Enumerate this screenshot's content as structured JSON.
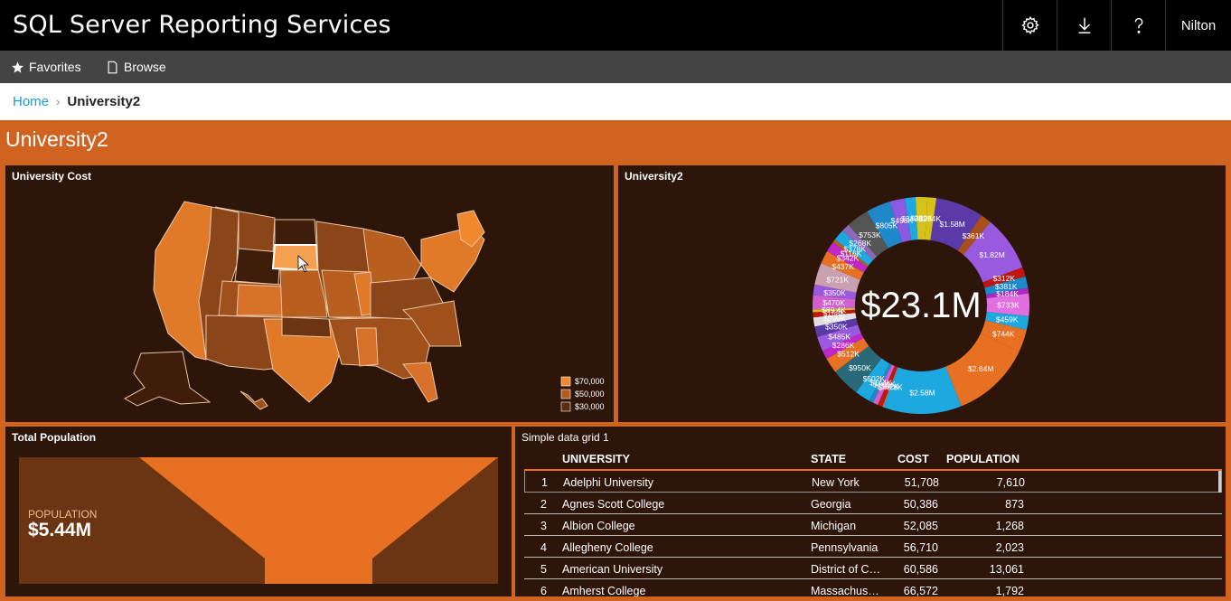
{
  "app": {
    "title": "SQL Server Reporting Services",
    "user": "Nilton"
  },
  "nav": {
    "favorites": "Favorites",
    "browse": "Browse"
  },
  "breadcrumb": {
    "home": "Home",
    "current": "University2"
  },
  "page": {
    "title": "University2"
  },
  "colors": {
    "accent": "#d0631f",
    "tile_bg": "#2e1509",
    "link": "#1c9bd7"
  },
  "tiles": {
    "map": {
      "title": "University Cost",
      "legend": [
        {
          "label": "$70,000",
          "color": "#f0882e"
        },
        {
          "label": "$50,000",
          "color": "#b05a1c"
        },
        {
          "label": "$30,000",
          "color": "#5c2e10"
        }
      ]
    },
    "donut": {
      "title": "University2",
      "center_value": "$23.1M",
      "labels": [
        "$294K",
        "$1.58M",
        "$361K",
        "$1.82M",
        "$312K",
        "$381K",
        "$184K",
        "$733K",
        "$459K",
        "$744K",
        "$2.64M",
        "$2.58M",
        "$48.8K",
        "$162K",
        "$169K",
        "$144K",
        "$502K",
        "$950K",
        "$512K",
        "$286K",
        "$485K",
        "$350K",
        "$299K",
        "$168K",
        "$89.4K",
        "$470K",
        "$350K",
        "$721K",
        "$437K",
        "$342K",
        "$116K",
        "$378K",
        "$268K",
        "$753K",
        "$805K",
        "$498K",
        "$349K",
        "$389K"
      ]
    },
    "funnel": {
      "title": "Total Population",
      "label": "POPULATION",
      "value": "$5.44M"
    },
    "grid": {
      "title": "Simple data grid 1",
      "columns": [
        "UNIVERSITY",
        "STATE",
        "COST",
        "POPULATION"
      ],
      "rows": [
        {
          "num": "1",
          "university": "Adelphi University",
          "state": "New York",
          "cost": "51,708",
          "population": "7,610"
        },
        {
          "num": "2",
          "university": "Agnes Scott College",
          "state": "Georgia",
          "cost": "50,386",
          "population": "873"
        },
        {
          "num": "3",
          "university": "Albion College",
          "state": "Michigan",
          "cost": "52,085",
          "population": "1,268"
        },
        {
          "num": "4",
          "university": "Allegheny College",
          "state": "Pennsylvania",
          "cost": "56,710",
          "population": "2,023"
        },
        {
          "num": "5",
          "university": "American University",
          "state": "District of Col...",
          "cost": "60,586",
          "population": "13,061"
        },
        {
          "num": "6",
          "university": "Amherst College",
          "state": "Massachusetts",
          "cost": "66,572",
          "population": "1,792"
        }
      ]
    }
  },
  "chart_data": {
    "type": "pie",
    "title": "University2",
    "center_label": "$23.1M",
    "values": [
      294,
      1580,
      361,
      1820,
      312,
      381,
      184,
      733,
      459,
      744,
      2640,
      2580,
      48.8,
      162,
      169,
      144,
      502,
      950,
      512,
      286,
      485,
      350,
      299,
      168,
      89.4,
      470,
      350,
      721,
      437,
      342,
      116,
      378,
      268,
      753,
      805,
      498,
      349,
      389
    ],
    "value_unit": "thousands USD"
  }
}
